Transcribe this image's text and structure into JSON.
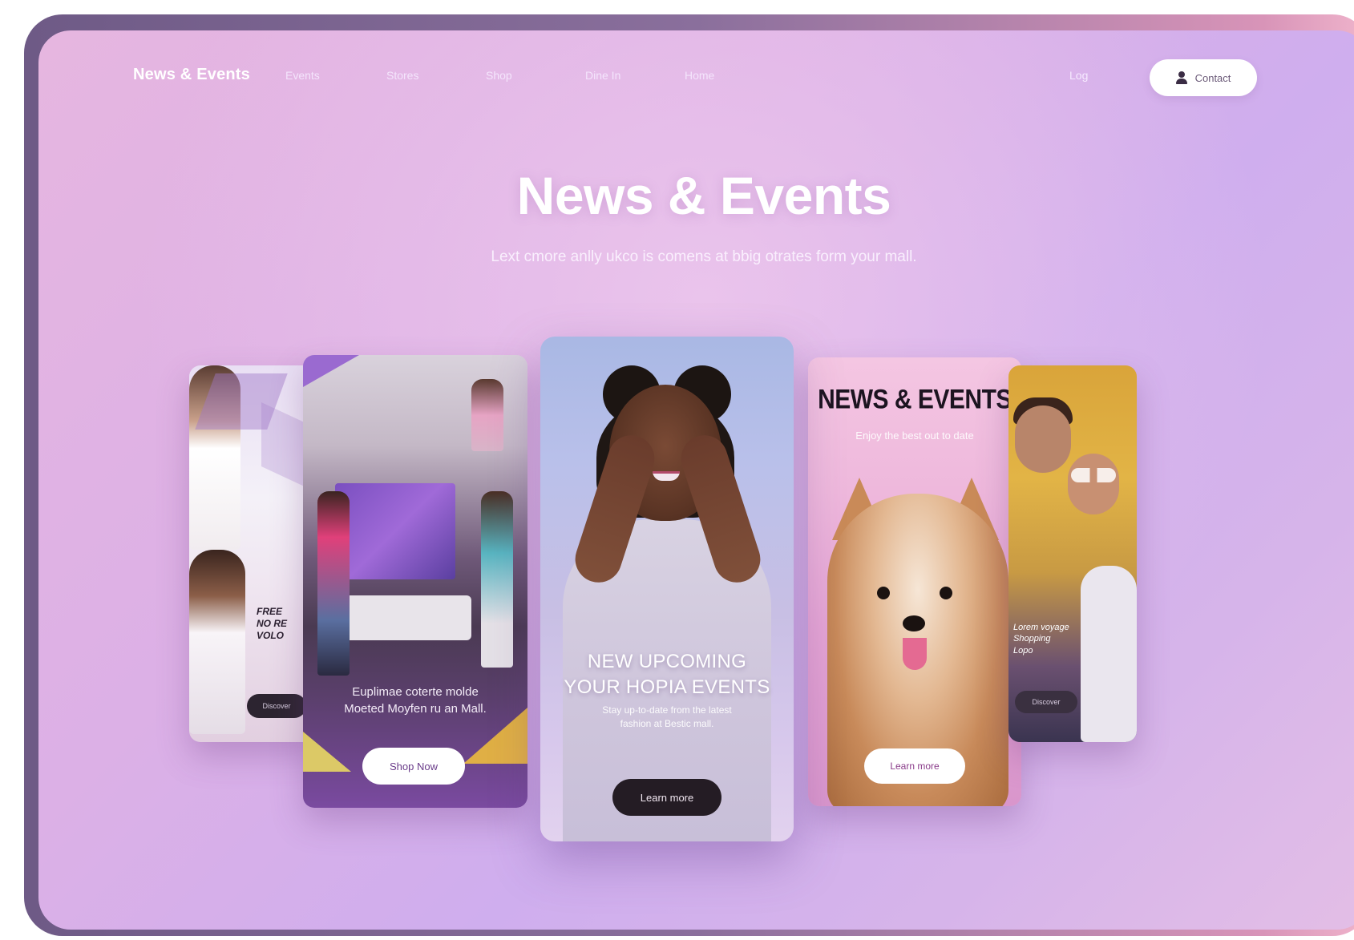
{
  "nav": {
    "brand": "News & Events",
    "links": [
      "Events",
      "Stores",
      "Shop",
      "Dine In",
      "Home"
    ],
    "login": "Log",
    "cta_label": "Contact",
    "cta_icon": "user-icon"
  },
  "hero": {
    "title": "News & Events",
    "subtitle": "Lext cmore anlly ukco is comens at bbig otrates form your mall."
  },
  "cards": {
    "card1": {
      "label_lines": [
        "FREE",
        "NO RE",
        "VOLO"
      ],
      "button": "Discover"
    },
    "card2": {
      "text_lines": [
        "Euplimae coterte molde",
        "Moeted Moyfen ru an Mall."
      ],
      "button": "Shop Now"
    },
    "card3": {
      "title_lines": [
        "NEW UPCOMING",
        "YOUR HOPIA EVENTS"
      ],
      "sub_lines": [
        "Stay up-to-date from the latest",
        "fashion at Bestic mall."
      ],
      "button": "Learn more"
    },
    "card4": {
      "headline": "NEWS & EVENTS",
      "tagline": "Enjoy the best out to date",
      "button": "Learn more"
    },
    "card5": {
      "label_lines": [
        "Lorem voyage",
        "Shopping",
        "Lopo"
      ],
      "button": "Discover"
    }
  },
  "colors": {
    "background": "#dcb0e6",
    "frame": "#6e5a86",
    "dark_button": "#241c24",
    "white": "#ffffff"
  }
}
